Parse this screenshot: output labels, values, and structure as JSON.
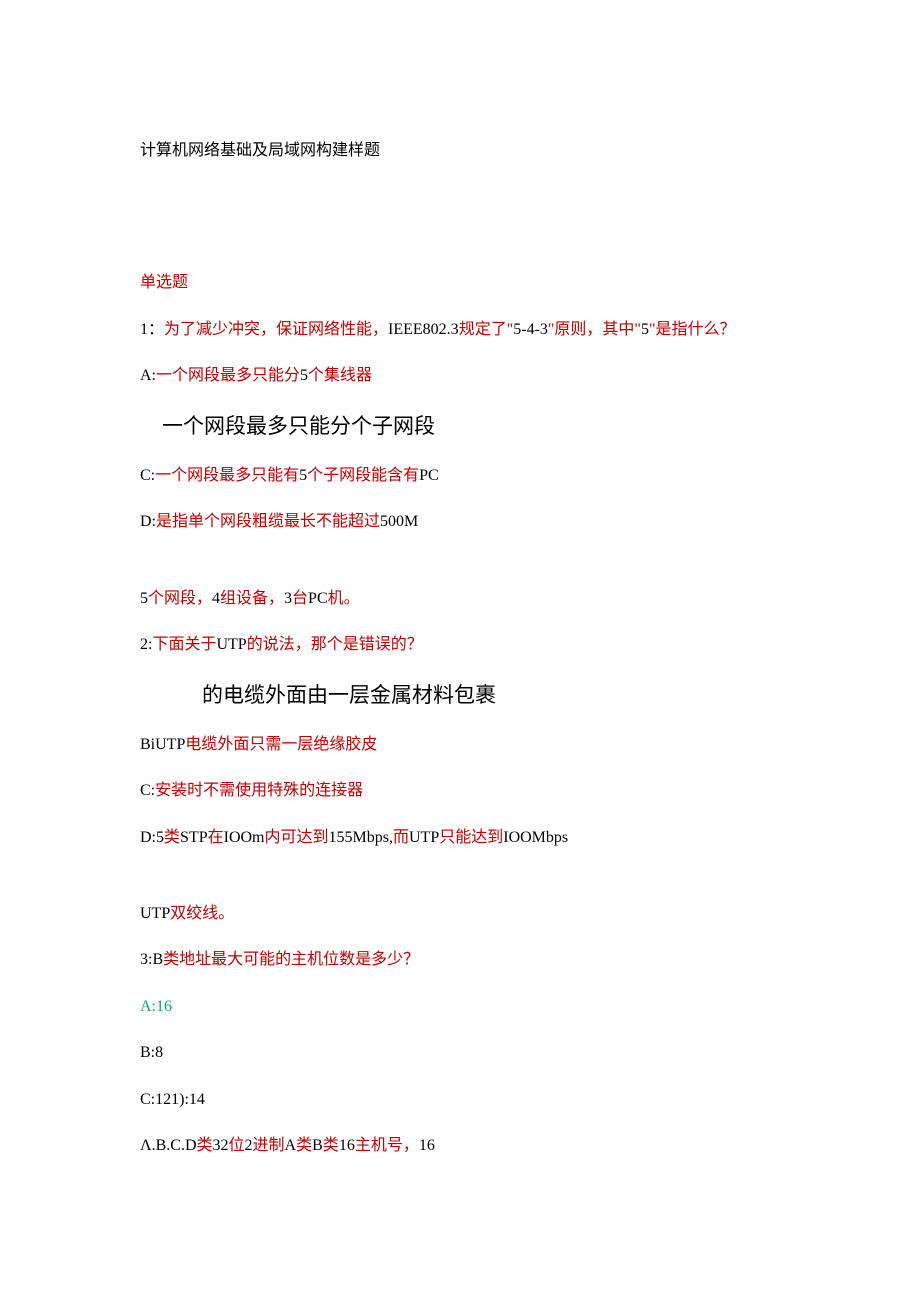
{
  "title": "计算机网络基础及局域网构建样题",
  "section_header": "单选题",
  "q1": {
    "prefix": "1：",
    "p1": "为了减少冲突，保证网络性能，",
    "ieee": "IEEE802.3",
    "p2": "规定了\"",
    "num": "5-4-3",
    "p3": "\"原则，其中\"",
    "five": "5",
    "p4": "\"是指什么？",
    "a_label": "A:",
    "a_p1": "一个网段最多只能分",
    "a_5": "5",
    "a_p2": "个集线器",
    "b_heading": "一个网段最多只能分个子网段",
    "c_label": "C:",
    "c_p1": "一个网段最多只能有",
    "c_5": "5",
    "c_p2": "个子网段能含有",
    "c_pc": "PC",
    "d_label": "D:",
    "d_p1": "是指单个网段粗缆最长不能超过",
    "d_500m": "500M",
    "exp_5": "5",
    "exp_p1": "个网段，",
    "exp_4": "4",
    "exp_p2": "组设备，",
    "exp_3": "3",
    "exp_tai": "台",
    "exp_pc": "PC",
    "exp_ji": "机。"
  },
  "q2": {
    "prefix": "2:",
    "p1": "下面关于",
    "utp": "UTP",
    "p2": "的说法，那个是错误的？",
    "a_heading": "的电缆外面由一层金属材料包裹",
    "b_label": "BiUTP",
    "b_text": "电缆外面只需一层绝缘胶皮",
    "c_label": "C:",
    "c_text": "安装时不需使用特殊的连接器",
    "d_label": "D:5",
    "d_p1": "类",
    "d_stp": "STP",
    "d_p2": "在",
    "d_100m": "IOOm",
    "d_p3": "内可达到",
    "d_155": "155Mbps,",
    "d_p4": "而",
    "d_utp": "UTP",
    "d_p5": "只能达到",
    "d_100mbps": "IOOMbps",
    "exp_utp": "UTP",
    "exp_text": "双绞线。"
  },
  "q3": {
    "prefix": "3:B",
    "text": "类地址最大可能的主机位数是多少？",
    "a": "A:16",
    "b": "B:8",
    "c": "C:121):14",
    "exp_p1": "Λ.B.C.D",
    "exp_p2": "类",
    "exp_32": "32",
    "exp_p3": "位",
    "exp_2": "2",
    "exp_p4": "进制",
    "exp_a": "A",
    "exp_p5": "类",
    "exp_b": "B",
    "exp_p6": "类",
    "exp_16": "16",
    "exp_p7": "主机号，",
    "exp_16b": "16"
  }
}
